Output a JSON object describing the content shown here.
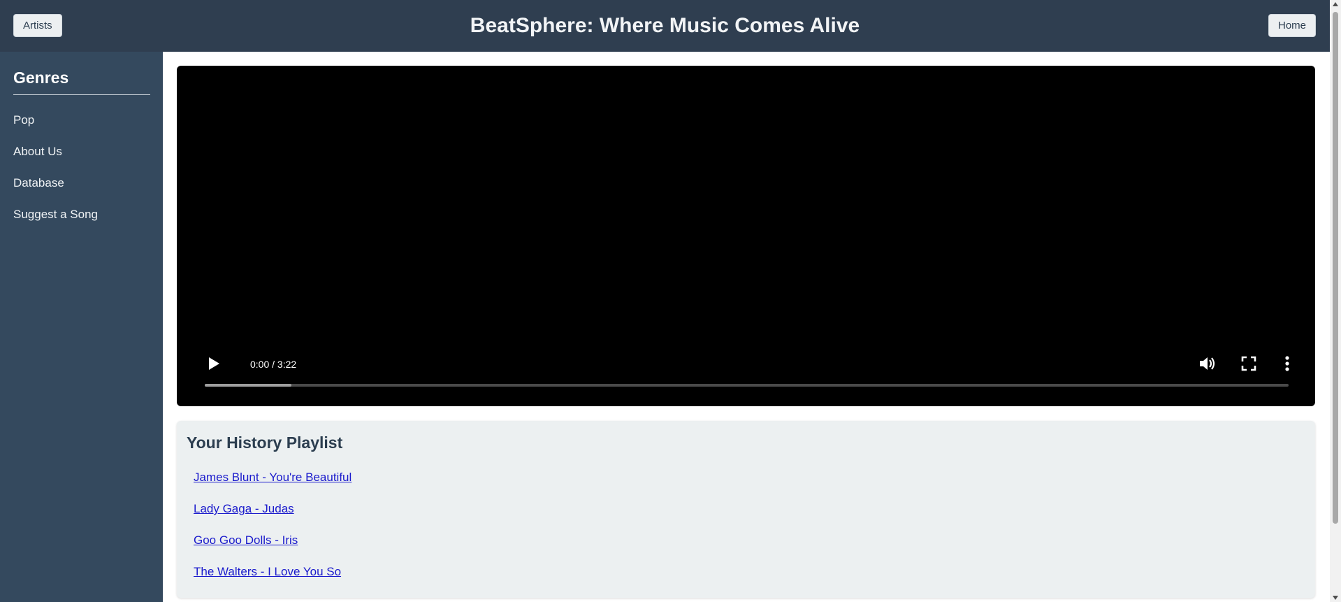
{
  "header": {
    "title": "BeatSphere: Where Music Comes Alive",
    "artists_label": "Artists",
    "home_label": "Home"
  },
  "sidebar": {
    "heading": "Genres",
    "items": [
      "Pop",
      "About Us",
      "Database",
      "Suggest a Song"
    ]
  },
  "video": {
    "time": "0:00 / 3:22",
    "buffered_fraction": 0.08,
    "icons": [
      "play-icon",
      "volume-icon",
      "fullscreen-icon",
      "more-options-icon"
    ]
  },
  "playlist": {
    "heading": "Your History Playlist",
    "items": [
      "James Blunt - You're Beautiful",
      "Lady Gaga - Judas",
      "Goo Goo Dolls - Iris",
      "The Walters - I Love You So"
    ]
  },
  "colors": {
    "header_bg": "#2f3e50",
    "sidebar_bg": "#34495e",
    "link": "#1a1acc",
    "playlist_bg": "#ecf0f1"
  }
}
